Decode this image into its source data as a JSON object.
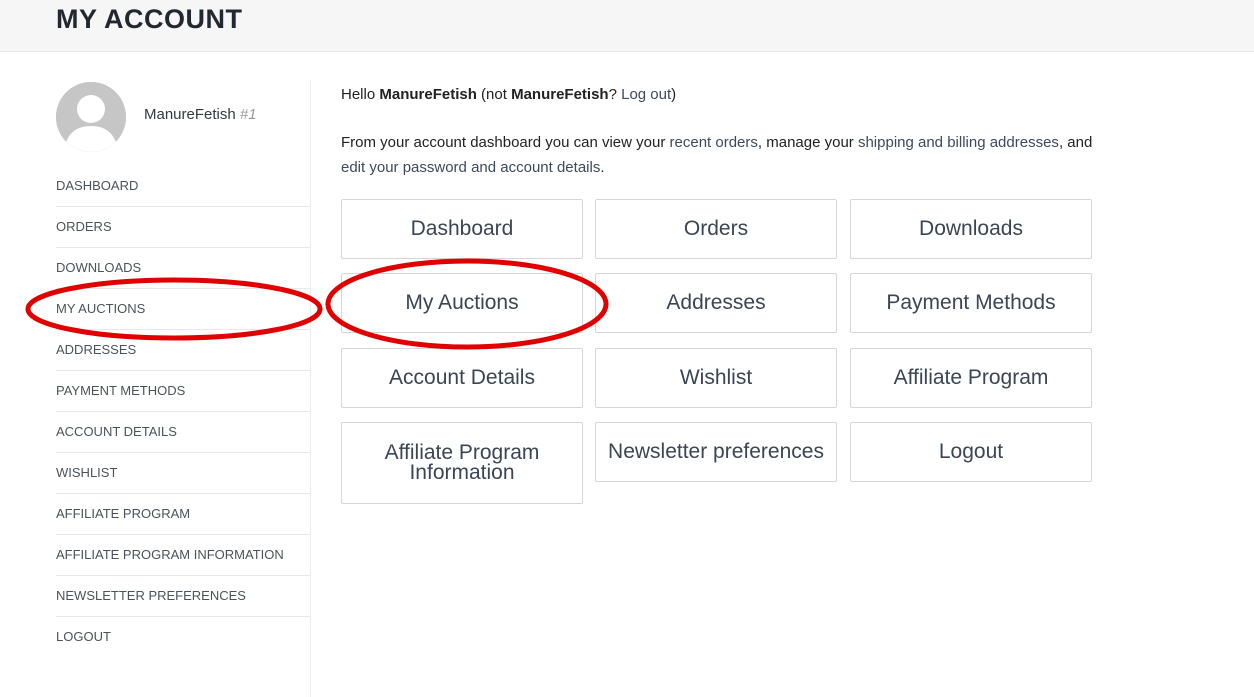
{
  "header": {
    "title": "MY ACCOUNT"
  },
  "user": {
    "name": "ManureFetish",
    "number": "#1"
  },
  "sidebar": {
    "items": [
      {
        "label": "DASHBOARD"
      },
      {
        "label": "ORDERS"
      },
      {
        "label": "DOWNLOADS"
      },
      {
        "label": "MY AUCTIONS"
      },
      {
        "label": "ADDRESSES"
      },
      {
        "label": "PAYMENT METHODS"
      },
      {
        "label": "ACCOUNT DETAILS"
      },
      {
        "label": "WISHLIST"
      },
      {
        "label": "AFFILIATE PROGRAM"
      },
      {
        "label": "AFFILIATE PROGRAM INFORMATION"
      },
      {
        "label": "NEWSLETTER PREFERENCES"
      },
      {
        "label": "LOGOUT"
      }
    ]
  },
  "main": {
    "greeting_hello": "Hello",
    "greeting_user": "ManureFetish",
    "greeting_not": "(not",
    "greeting_user2": "ManureFetish",
    "greeting_q": "?",
    "greeting_logout": "Log out",
    "greeting_close": ")",
    "intro_1": "From your account dashboard you can view your",
    "intro_recent_orders": "recent orders",
    "intro_2": ", manage your",
    "intro_addresses": "shipping and billing addresses",
    "intro_3": ", and",
    "intro_edit": "edit your password and account details",
    "intro_4": "."
  },
  "tiles": [
    {
      "label": "Dashboard"
    },
    {
      "label": "Orders"
    },
    {
      "label": "Downloads"
    },
    {
      "label": "My Auctions"
    },
    {
      "label": "Addresses"
    },
    {
      "label": "Payment Methods"
    },
    {
      "label": "Account Details"
    },
    {
      "label": "Wishlist"
    },
    {
      "label": "Affiliate Program"
    },
    {
      "label": "Affiliate Program Information"
    },
    {
      "label": "Newsletter preferences"
    },
    {
      "label": "Logout"
    }
  ],
  "annotation": {
    "color": "#e00000"
  }
}
